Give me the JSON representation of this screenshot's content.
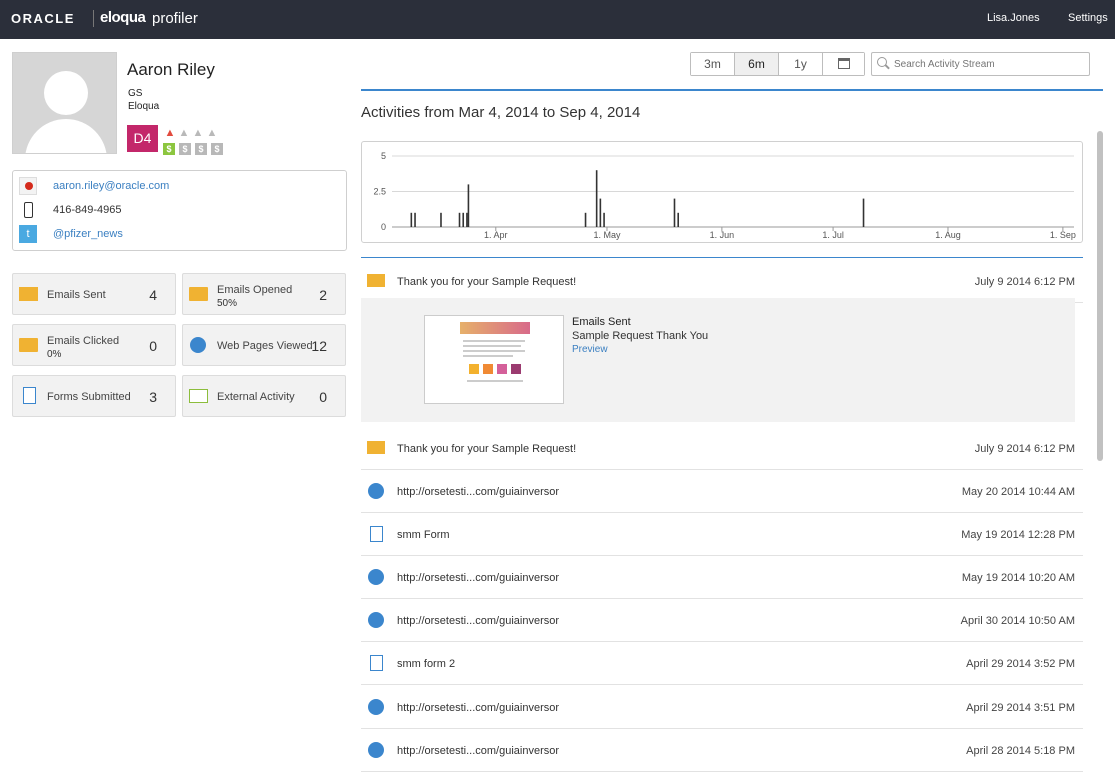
{
  "topbar": {
    "oracle": "ORACLE",
    "eloqua": "eloqua",
    "app": "profiler",
    "user": "Lisa.Jones",
    "settings": "Settings"
  },
  "profile": {
    "name": "Aaron Riley",
    "title": "GS",
    "company": "Eloqua",
    "score": "D4",
    "flames_active": 1,
    "flames_total": 4,
    "dollars_active": 1,
    "dollars_total": 4
  },
  "contact": {
    "email": "aaron.riley@oracle.com",
    "phone": "416-849-4965",
    "twitter": "@pfizer_news"
  },
  "stats": [
    {
      "label": "Emails Sent",
      "sub": "",
      "value": "4"
    },
    {
      "label": "Emails Opened",
      "sub": "50%",
      "value": "2"
    },
    {
      "label": "Emails Clicked",
      "sub": "0%",
      "value": "0"
    },
    {
      "label": "Web Pages Viewed",
      "sub": "",
      "value": "12"
    },
    {
      "label": "Forms Submitted",
      "sub": "",
      "value": "3"
    },
    {
      "label": "External Activity",
      "sub": "",
      "value": "0"
    }
  ],
  "controls": {
    "tabs": [
      "3m",
      "6m",
      "1y"
    ],
    "active_tab": "6m",
    "search_placeholder": "Search Activity Stream"
  },
  "range_title": "Activities from Mar 4, 2014 to Sep 4, 2014",
  "chart_data": {
    "type": "bar",
    "yticks": [
      "5",
      "2.5",
      "0"
    ],
    "ylim": [
      0,
      5
    ],
    "xticks": [
      "1. Apr",
      "1. May",
      "1. Jun",
      "1. Jul",
      "1. Aug",
      "1. Sep"
    ],
    "grid": true,
    "series": [
      {
        "x": [
          "2014-03-09",
          "2014-03-10",
          "2014-03-17",
          "2014-03-22",
          "2014-03-23",
          "2014-03-24",
          "2014-03-24",
          "2014-04-25",
          "2014-04-28",
          "2014-04-29",
          "2014-04-30",
          "2014-05-19",
          "2014-05-20",
          "2014-07-09"
        ],
        "values": [
          1,
          1,
          1,
          1,
          1,
          1,
          3,
          1,
          4,
          2,
          1,
          2,
          1,
          2
        ]
      }
    ]
  },
  "expanded": {
    "title": "Emails Sent",
    "subtitle": "Sample Request Thank You",
    "preview": "Preview"
  },
  "activities": [
    {
      "icon": "envelope",
      "text": "Thank you for your Sample Request!",
      "date": "July 9 2014 6:12 PM"
    },
    {
      "icon": "envelope",
      "text": "Thank you for your Sample Request!",
      "date": "July 9 2014 6:12 PM"
    },
    {
      "icon": "globe",
      "text": "http://orsetesti...com/guiainversor",
      "date": "May 20 2014 10:44 AM"
    },
    {
      "icon": "form",
      "text": "smm Form",
      "date": "May 19 2014 12:28 PM"
    },
    {
      "icon": "globe",
      "text": "http://orsetesti...com/guiainversor",
      "date": "May 19 2014 10:20 AM"
    },
    {
      "icon": "globe",
      "text": "http://orsetesti...com/guiainversor",
      "date": "April 30 2014 10:50 AM"
    },
    {
      "icon": "form",
      "text": "smm form 2",
      "date": "April 29 2014 3:52 PM"
    },
    {
      "icon": "globe",
      "text": "http://orsetesti...com/guiainversor",
      "date": "April 29 2014 3:51 PM"
    },
    {
      "icon": "globe",
      "text": "http://orsetesti...com/guiainversor",
      "date": "April 28 2014 5:18 PM"
    }
  ]
}
